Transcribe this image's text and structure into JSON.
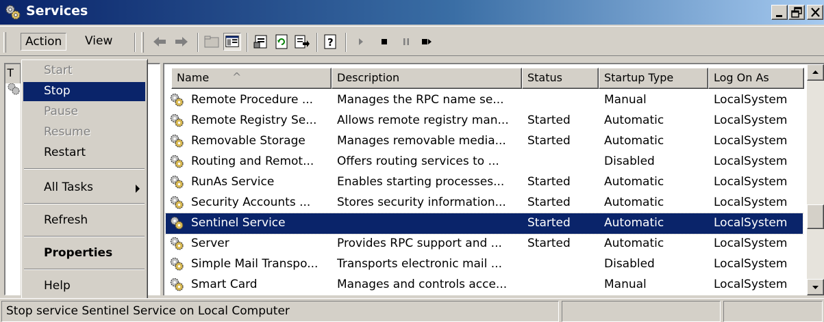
{
  "window": {
    "title": "Services",
    "controls": {
      "minimize": "minimize",
      "restore": "restore",
      "close": "close"
    }
  },
  "menubar": {
    "action": "Action",
    "view": "View"
  },
  "toolbar": {
    "icons": [
      "back-arrow-icon",
      "forward-arrow-icon",
      "up-folder-icon",
      "show-hide-console-tree-icon",
      "properties-icon",
      "refresh-icon",
      "export-list-icon",
      "help-icon",
      "start-service-icon",
      "stop-service-icon",
      "pause-service-icon",
      "restart-service-icon"
    ]
  },
  "left_pane": {
    "tab_label": "T"
  },
  "context_menu": {
    "items": [
      {
        "label": "Start",
        "state": "disabled"
      },
      {
        "label": "Stop",
        "state": "highlighted"
      },
      {
        "label": "Pause",
        "state": "disabled"
      },
      {
        "label": "Resume",
        "state": "disabled"
      },
      {
        "label": "Restart",
        "state": "enabled"
      },
      {
        "label": "All Tasks",
        "state": "submenu"
      },
      {
        "label": "Refresh",
        "state": "enabled"
      },
      {
        "label": "Properties",
        "state": "bold"
      },
      {
        "label": "Help",
        "state": "enabled"
      }
    ]
  },
  "list": {
    "columns": [
      "Name",
      "Description",
      "Status",
      "Startup Type",
      "Log On As"
    ],
    "sort_indicator": "^",
    "rows": [
      {
        "name": "Remote Procedure ...",
        "description": "Manages the RPC name se...",
        "status": "",
        "startup": "Manual",
        "logon": "LocalSystem"
      },
      {
        "name": "Remote Registry Se...",
        "description": "Allows remote registry man...",
        "status": "Started",
        "startup": "Automatic",
        "logon": "LocalSystem"
      },
      {
        "name": "Removable Storage",
        "description": "Manages removable media...",
        "status": "Started",
        "startup": "Automatic",
        "logon": "LocalSystem"
      },
      {
        "name": "Routing and Remot...",
        "description": "Offers routing services to ...",
        "status": "",
        "startup": "Disabled",
        "logon": "LocalSystem"
      },
      {
        "name": "RunAs Service",
        "description": "Enables starting processes...",
        "status": "Started",
        "startup": "Automatic",
        "logon": "LocalSystem"
      },
      {
        "name": "Security Accounts ...",
        "description": "Stores security information...",
        "status": "Started",
        "startup": "Automatic",
        "logon": "LocalSystem"
      },
      {
        "name": "Sentinel Service",
        "description": "",
        "status": "Started",
        "startup": "Automatic",
        "logon": "LocalSystem",
        "selected": true
      },
      {
        "name": "Server",
        "description": "Provides RPC support and ...",
        "status": "Started",
        "startup": "Automatic",
        "logon": "LocalSystem"
      },
      {
        "name": "Simple Mail Transpo...",
        "description": "Transports electronic mail ...",
        "status": "",
        "startup": "Disabled",
        "logon": "LocalSystem"
      },
      {
        "name": "Smart Card",
        "description": "Manages and controls acce...",
        "status": "",
        "startup": "Manual",
        "logon": "LocalSystem"
      }
    ]
  },
  "statusbar": {
    "text": "Stop service Sentinel Service on Local Computer"
  }
}
